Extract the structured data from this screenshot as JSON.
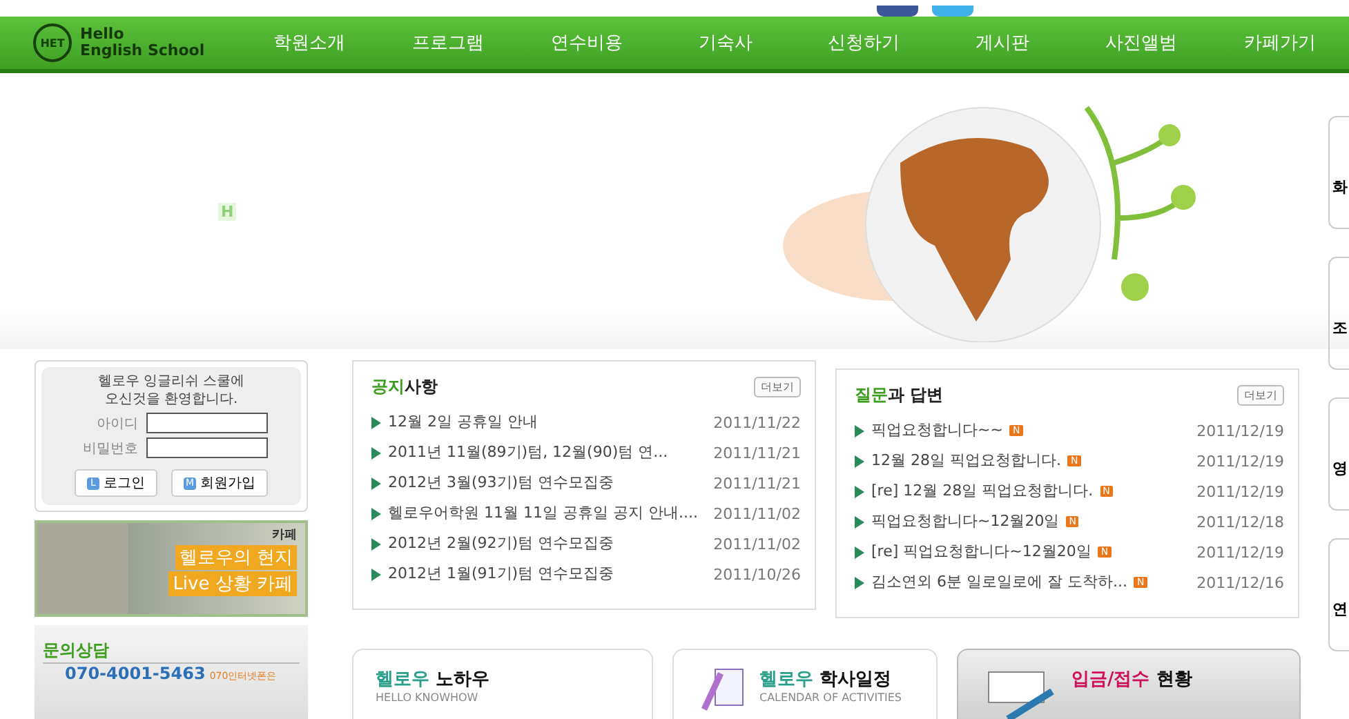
{
  "header": {
    "logo": {
      "mark": "HET",
      "line1": "Hello",
      "line2": "English School"
    },
    "menu": [
      "학원소개",
      "프로그램",
      "연수비용",
      "기숙사",
      "신청하기",
      "게시판",
      "사진앨범",
      "카페가기"
    ]
  },
  "hero": {
    "mark": "H"
  },
  "login": {
    "welcome": [
      "헬로우 잉글리쉬 스쿨에",
      "오신것을 환영합니다."
    ],
    "fields": [
      {
        "label": "아이디"
      },
      {
        "label": "비밀번호"
      }
    ],
    "buttons": [
      {
        "letter": "L",
        "label": "로그인"
      },
      {
        "letter": "M",
        "label": "회원가입"
      }
    ]
  },
  "cafe_banner": {
    "brand": "카페",
    "line1": "헬로우의 현지",
    "line2": "Live 상황 카페"
  },
  "contact": {
    "title": "문의상담",
    "phone": "070-4001-5463",
    "note": "070인터넷폰은"
  },
  "notice": {
    "title_accent": "공지",
    "title_rest": "사항",
    "more": "더보기",
    "items": [
      {
        "title": "12월 2일 공휴일 안내",
        "date": "2011/11/22"
      },
      {
        "title": "2011년 11월(89기)텀, 12월(90)텀 연...",
        "date": "2011/11/21"
      },
      {
        "title": "2012년 3월(93기)텀 연수모집중",
        "date": "2011/11/21"
      },
      {
        "title": "헬로우어학원 11월 11일 공휴일 공지 안내....",
        "date": "2011/11/02"
      },
      {
        "title": "2012년 2월(92기)텀 연수모집중",
        "date": "2011/11/02"
      },
      {
        "title": "2012년 1월(91기)텀 연수모집중",
        "date": "2011/10/26"
      }
    ]
  },
  "qna": {
    "title_accent": "질문",
    "title_rest": "과 답변",
    "more": "더보기",
    "items": [
      {
        "title": "픽업요청합니다~~",
        "date": "2011/12/19",
        "badge": "N"
      },
      {
        "title": "12월 28일 픽업요청합니다.",
        "date": "2011/12/19",
        "badge": "N"
      },
      {
        "title": "[re] 12월 28일 픽업요청합니다.",
        "date": "2011/12/19",
        "badge": "N"
      },
      {
        "title": "픽업요청합니다~12월20일",
        "date": "2011/12/18",
        "badge": "N"
      },
      {
        "title": "[re] 픽업요청합니다~12월20일",
        "date": "2011/12/19",
        "badge": "N"
      },
      {
        "title": "김소연외 6분 일로일로에 잘 도착하...",
        "date": "2011/12/16",
        "badge": "N"
      }
    ]
  },
  "cards": [
    {
      "kind": "plain",
      "accent": "헬로우",
      "rest": "노하우",
      "sub": "HELLO KNOWHOW"
    },
    {
      "kind": "icon",
      "accent": "헬로우",
      "rest": "학사일정",
      "sub": "CALENDAR OF ACTIVITIES"
    },
    {
      "kind": "grey",
      "accent": "입금/접수",
      "rest": "현황"
    }
  ],
  "side_tabs": [
    "화",
    "조",
    "영",
    "연"
  ]
}
